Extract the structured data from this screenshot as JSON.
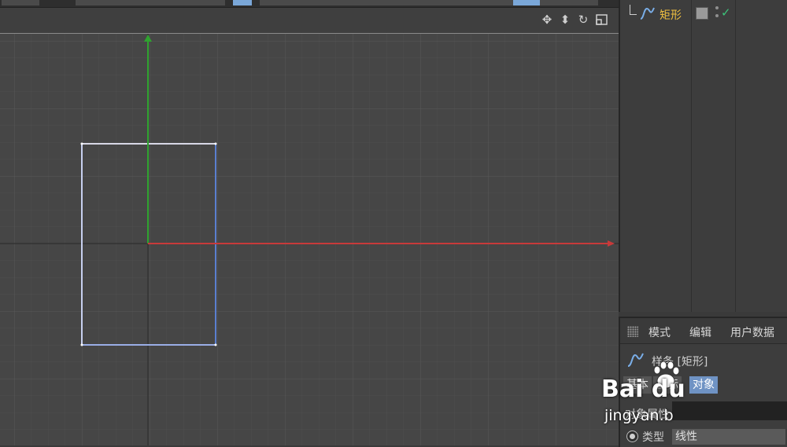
{
  "object_manager": {
    "object_name": "矩形",
    "icons": [
      "spline-icon",
      "tag-icon",
      "visibility-dots-icon",
      "checkmark-icon"
    ]
  },
  "attribute_manager": {
    "menu": [
      "模式",
      "编辑",
      "用户数据"
    ],
    "object_title": "样条 [矩形]",
    "tabs": [
      "基本",
      "坐标",
      "对象"
    ],
    "section_label": "对象属性",
    "type_label": "类型",
    "type_value": "线性"
  },
  "viewport": {
    "nav_icons": [
      "move-icon",
      "zoom-icon",
      "rotate-icon",
      "maximize-icon"
    ]
  },
  "watermark": {
    "logo": "Bai du",
    "url": "jingyan.b"
  },
  "colors": {
    "accent": "#6f93c4",
    "object_name": "#f0c040",
    "y_axis": "#2fa32f",
    "x_axis": "#c83a3a"
  }
}
